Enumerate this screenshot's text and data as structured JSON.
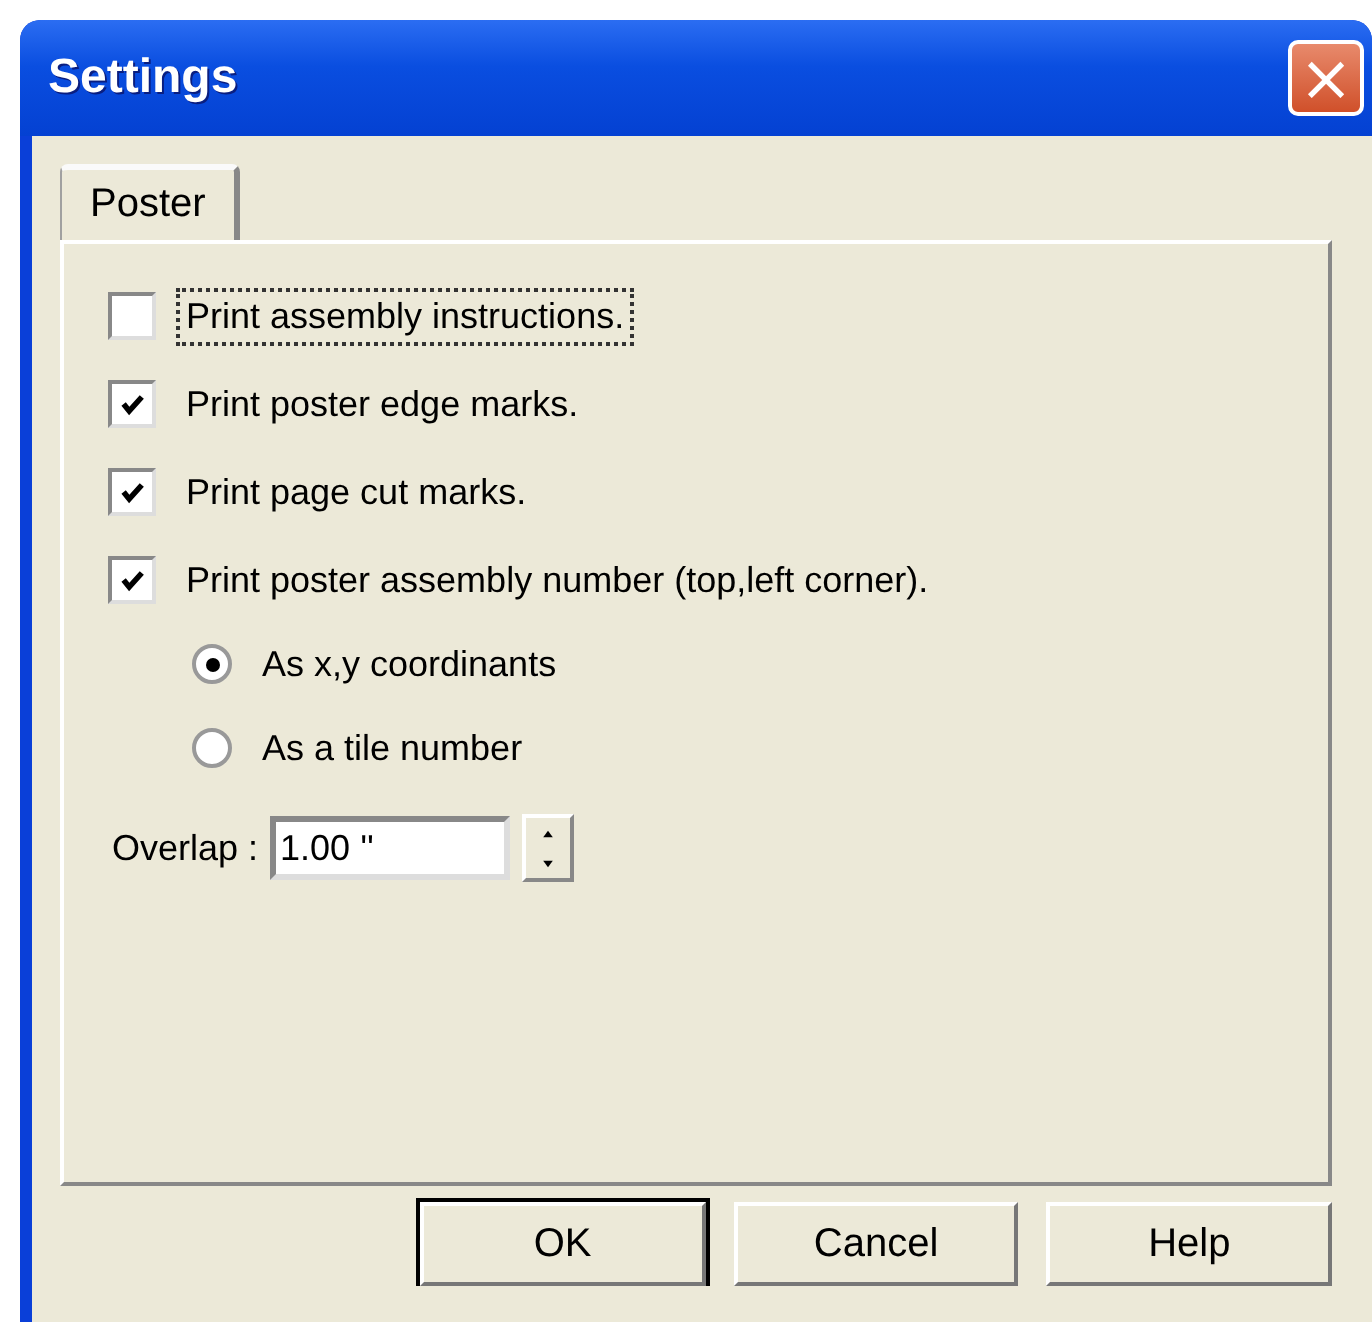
{
  "window": {
    "title": "Settings",
    "close": "×"
  },
  "tabs": [
    {
      "label": "Poster",
      "selected": true
    }
  ],
  "options": [
    {
      "kind": "checkbox",
      "label": "Print assembly instructions.",
      "checked": false,
      "focused": true
    },
    {
      "kind": "checkbox",
      "label": "Print poster edge marks.",
      "checked": true,
      "focused": false
    },
    {
      "kind": "checkbox",
      "label": "Print page cut marks.",
      "checked": true,
      "focused": false
    },
    {
      "kind": "checkbox",
      "label": "Print poster assembly number (top,left corner).",
      "checked": true,
      "focused": false,
      "children": [
        {
          "kind": "radio",
          "label": "As x,y coordinants",
          "selected": true
        },
        {
          "kind": "radio",
          "label": "As a tile number",
          "selected": false
        }
      ]
    }
  ],
  "overlap": {
    "label": "Overlap :",
    "value": "1.00 ''"
  },
  "buttons": [
    {
      "label": "OK",
      "default": true
    },
    {
      "label": "Cancel",
      "default": false
    },
    {
      "label": "Help",
      "default": false
    }
  ]
}
